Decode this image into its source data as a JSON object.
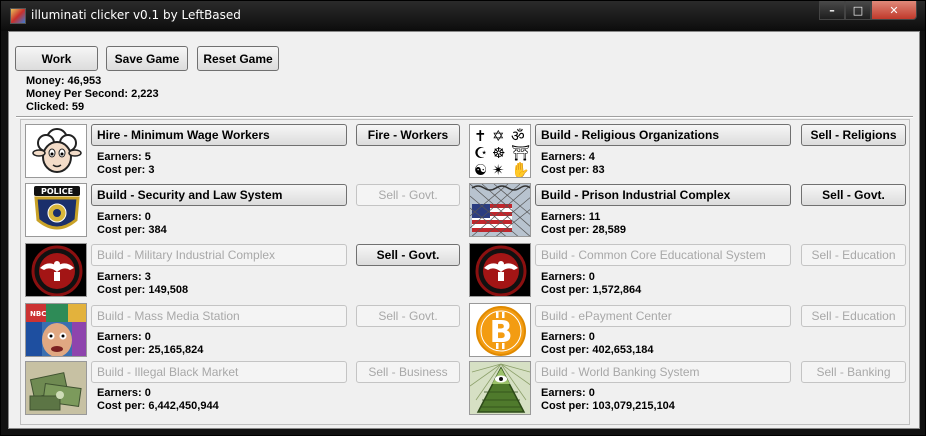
{
  "window": {
    "title": "illuminati clicker v0.1 by LeftBased"
  },
  "top": {
    "work_label": "Work",
    "save_label": "Save Game",
    "reset_label": "Reset Game",
    "money": "Money: 46,953",
    "mps": "Money Per Second: 2,223",
    "clicked": "Clicked: 59"
  },
  "items": [
    {
      "image": "sheep-icon",
      "build_label": "Hire - Minimum Wage Workers",
      "build_enabled": true,
      "sell_label": "Fire - Workers",
      "sell_enabled": true,
      "earners": "Earners: 5",
      "cost": "Cost per: 3"
    },
    {
      "image": "religious-symbols-icon",
      "build_label": "Build - Religious Organizations",
      "build_enabled": true,
      "sell_label": "Sell - Religions",
      "sell_enabled": true,
      "earners": "Earners: 4",
      "cost": "Cost per: 83"
    },
    {
      "image": "police-badge-icon",
      "build_label": "Build - Security and Law System",
      "build_enabled": true,
      "sell_label": "Sell - Govt.",
      "sell_enabled": false,
      "earners": "Earners: 0",
      "cost": "Cost per: 384"
    },
    {
      "image": "prison-fence-flag-icon",
      "build_label": "Build - Prison Industrial Complex",
      "build_enabled": true,
      "sell_label": "Sell - Govt.",
      "sell_enabled": true,
      "earners": "Earners: 11",
      "cost": "Cost per: 28,589"
    },
    {
      "image": "eagle-seal-icon",
      "build_label": "Build - Military Industrial Complex",
      "build_enabled": false,
      "sell_label": "Sell - Govt.",
      "sell_enabled": true,
      "earners": "Earners: 3",
      "cost": "Cost per: 149,508"
    },
    {
      "image": "eagle-seal-icon",
      "build_label": "Build - Common Core Educational System",
      "build_enabled": false,
      "sell_label": "Sell - Education",
      "sell_enabled": false,
      "earners": "Earners: 0",
      "cost": "Cost per: 1,572,864"
    },
    {
      "image": "tv-media-icon",
      "build_label": "Build - Mass Media Station",
      "build_enabled": false,
      "sell_label": "Sell - Govt.",
      "sell_enabled": false,
      "earners": "Earners: 0",
      "cost": "Cost per: 25,165,824"
    },
    {
      "image": "bitcoin-icon",
      "build_label": "Build - ePayment Center",
      "build_enabled": false,
      "sell_label": "Sell - Education",
      "sell_enabled": false,
      "earners": "Earners: 0",
      "cost": "Cost per: 402,653,184"
    },
    {
      "image": "cash-pile-icon",
      "build_label": "Build - Illegal Black Market",
      "build_enabled": false,
      "sell_label": "Sell - Business",
      "sell_enabled": false,
      "earners": "Earners: 0",
      "cost": "Cost per: 6,442,450,944"
    },
    {
      "image": "pyramid-eye-icon",
      "build_label": "Build - World Banking System",
      "build_enabled": false,
      "sell_label": "Sell - Banking",
      "sell_enabled": false,
      "earners": "Earners: 0",
      "cost": "Cost per: 103,079,215,104"
    }
  ],
  "colors": {
    "title_bar": "#1a1a1a",
    "client_bg": "#f0f0f0",
    "close_button": "#c0392b",
    "disabled_text": "#a8a8a8"
  }
}
